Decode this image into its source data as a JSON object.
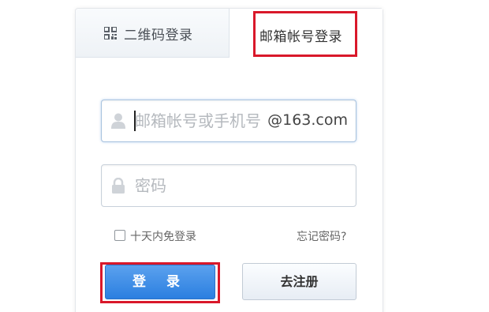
{
  "tabs": {
    "qr_label": "二维码登录",
    "mail_label": "邮箱帐号登录",
    "active": "mail"
  },
  "account_field": {
    "placeholder": "邮箱帐号或手机号",
    "value": "",
    "suffix": "@163.com",
    "icon": "user-icon"
  },
  "password_field": {
    "placeholder": "密码",
    "value": "",
    "icon": "lock-icon"
  },
  "remember": {
    "label": "十天内免登录",
    "checked": false
  },
  "forgot_label": "忘记密码?",
  "login_button_label": "登 录",
  "register_button_label": "去注册",
  "colors": {
    "highlight": "#d9182a",
    "primary_button": "#2b7fe0",
    "input_focus_border": "#a9c4e0"
  }
}
